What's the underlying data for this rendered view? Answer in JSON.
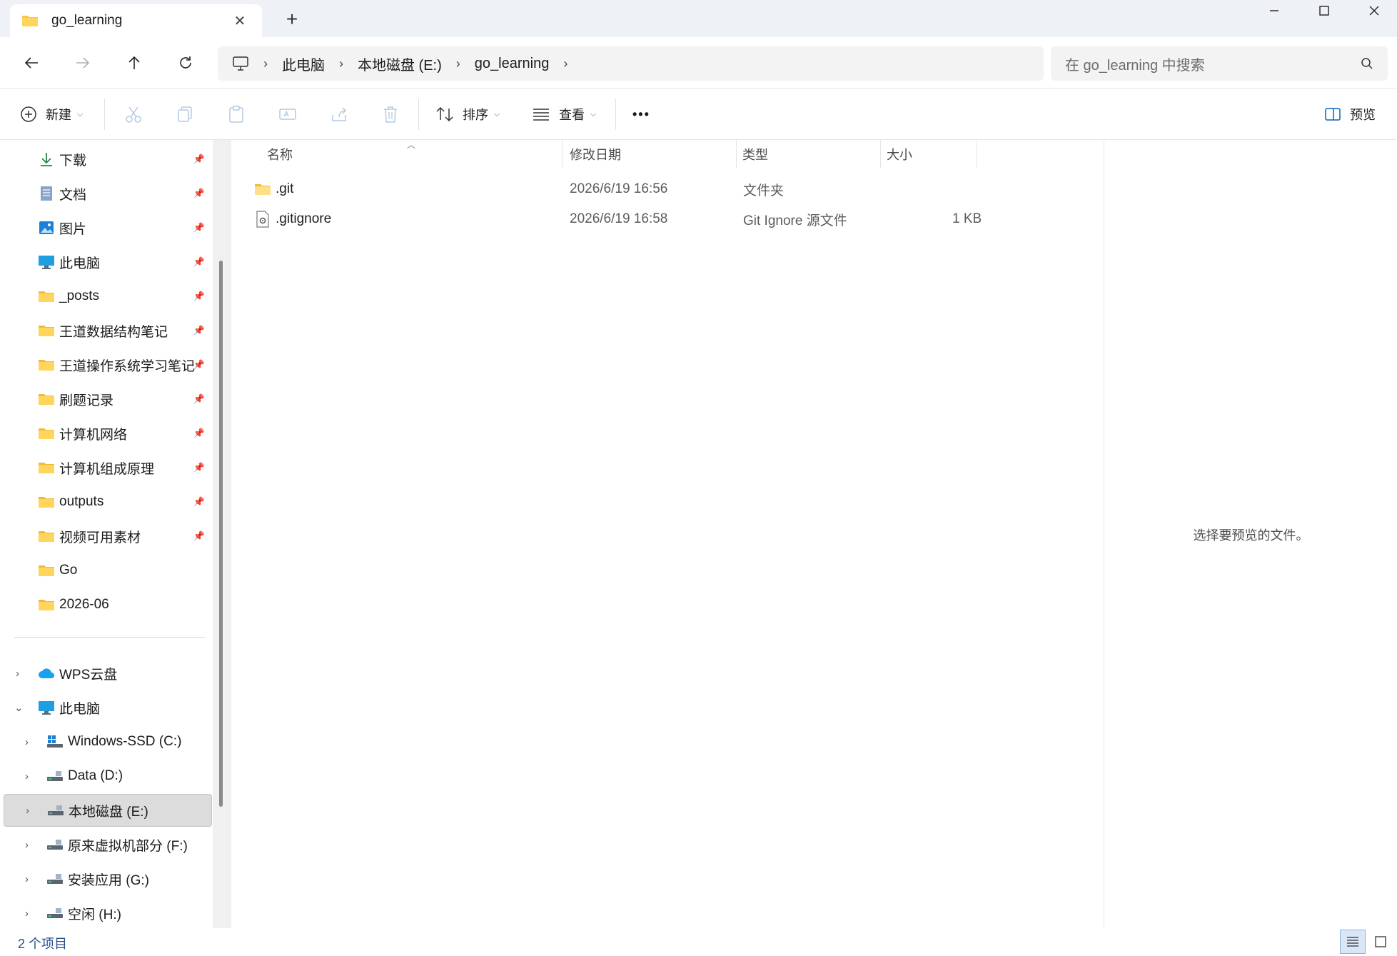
{
  "window": {
    "tab_title": "go_learning",
    "new_tab": "+",
    "minimize": "minimize-icon",
    "maximize": "maximize-icon",
    "close": "close-icon"
  },
  "nav": {
    "breadcrumbs": [
      "此电脑",
      "本地磁盘 (E:)",
      "go_learning"
    ],
    "search_placeholder": "在 go_learning 中搜索"
  },
  "commands": {
    "new_label": "新建",
    "sort_label": "排序",
    "view_label": "查看",
    "more_label": "•••",
    "preview_label": "预览"
  },
  "sidebar": {
    "quick_access": [
      {
        "label": "下载",
        "icon": "download-icon"
      },
      {
        "label": "文档",
        "icon": "document-icon"
      },
      {
        "label": "图片",
        "icon": "pictures-icon"
      },
      {
        "label": "此电脑",
        "icon": "computer-icon"
      },
      {
        "label": "_posts",
        "icon": "folder-icon"
      },
      {
        "label": "王道数据结构笔记",
        "icon": "folder-icon"
      },
      {
        "label": "王道操作系统学习笔记",
        "icon": "folder-icon"
      },
      {
        "label": "刷题记录",
        "icon": "folder-icon"
      },
      {
        "label": "计算机网络",
        "icon": "folder-icon"
      },
      {
        "label": "计算机组成原理",
        "icon": "folder-icon"
      },
      {
        "label": "outputs",
        "icon": "folder-icon"
      },
      {
        "label": "视频可用素材",
        "icon": "folder-icon"
      },
      {
        "label": "Go",
        "icon": "folder-icon"
      },
      {
        "label": "2026-06",
        "icon": "folder-icon"
      }
    ],
    "wps": "WPS云盘",
    "this_pc": "此电脑",
    "drives": [
      {
        "label": "Windows-SSD (C:)"
      },
      {
        "label": "Data (D:)"
      },
      {
        "label": "本地磁盘 (E:)"
      },
      {
        "label": "原来虚拟机部分 (F:)"
      },
      {
        "label": "安装应用 (G:)"
      },
      {
        "label": "空闲 (H:)"
      }
    ]
  },
  "columns": {
    "name": "名称",
    "modified": "修改日期",
    "type": "类型",
    "size": "大小"
  },
  "files": [
    {
      "name": ".git",
      "modified": "2026/6/19 16:56",
      "type": "文件夹",
      "size": "",
      "icon": "folder-icon"
    },
    {
      "name": ".gitignore",
      "modified": "2026/6/19 16:58",
      "type": "Git Ignore 源文件",
      "size": "1 KB",
      "icon": "settings-file-icon"
    }
  ],
  "preview": {
    "message": "选择要预览的文件。"
  },
  "status": {
    "item_count": "2 个项目"
  },
  "colors": {
    "folder": "#f8c84a",
    "accent": "#0067c0",
    "selected_bg": "#dcdcdc"
  }
}
